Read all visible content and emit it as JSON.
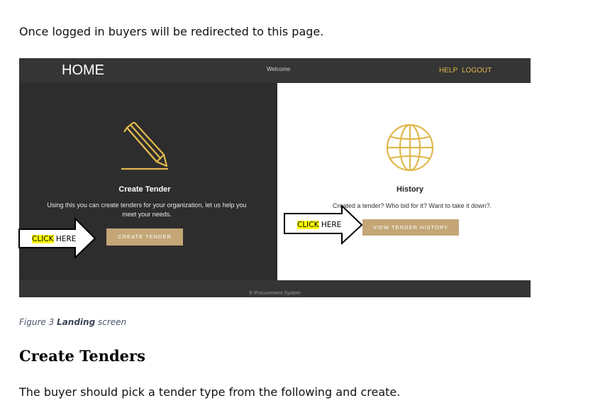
{
  "document": {
    "intro": "Once logged in buyers will be redirected to this page.",
    "caption_prefix": "Figure 3 ",
    "caption_bold": "Landing",
    "caption_suffix": " screen",
    "heading": "Create Tenders",
    "outro": "The buyer should pick a tender type from the following and create."
  },
  "screenshot": {
    "nav": {
      "home": "HOME",
      "welcome": "Welcome",
      "help": "HELP",
      "logout": "LOGOUT"
    },
    "create_panel": {
      "icon": "pencil-icon",
      "title": "Create Tender",
      "description": "Using this you can create tenders for your organization, let us help you meet your needs.",
      "button": "CREATE TENDER"
    },
    "history_panel": {
      "icon": "globe-icon",
      "title": "History",
      "description": "Created a tender? Who bid for it? Want to take it down?.",
      "button": "VIEW TENDER HISTORY"
    },
    "footer": "E-Procurement System"
  },
  "annotations": {
    "left_click": {
      "highlight": "CLICK",
      "rest": " HERE"
    },
    "right_click": {
      "highlight": "CLICK",
      "rest": " HERE"
    }
  },
  "colors": {
    "dark_bg": "#2e2d2d",
    "nav_bg": "#363535",
    "accent_gold": "#e0b94e",
    "button_tan": "#c4a677",
    "highlight": "#ffff00"
  }
}
